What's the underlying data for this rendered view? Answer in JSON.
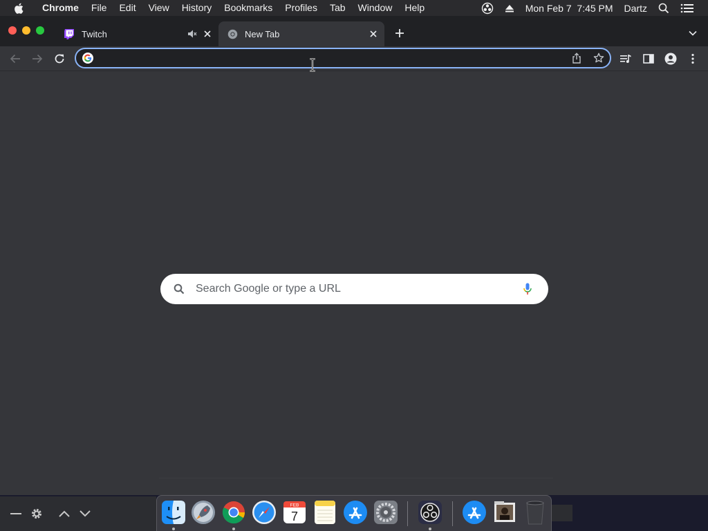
{
  "menubar": {
    "app_name": "Chrome",
    "items": [
      "File",
      "Edit",
      "View",
      "History",
      "Bookmarks",
      "Profiles",
      "Tab",
      "Window",
      "Help"
    ],
    "datetime": "Mon Feb 7  7:45 PM",
    "user": "Dartz"
  },
  "tabs": [
    {
      "title": "Twitch",
      "active": false,
      "muted": true
    },
    {
      "title": "New Tab",
      "active": true
    }
  ],
  "omnibox": {
    "value": "",
    "placeholder": ""
  },
  "ntp": {
    "search_placeholder": "Search Google or type a URL"
  },
  "dock": {
    "apps": [
      "Finder",
      "Launchpad",
      "Google Chrome",
      "Safari",
      "Calendar",
      "Notes",
      "App Store",
      "System Preferences",
      "OBS",
      "Applications",
      "Downloads",
      "Trash"
    ],
    "calendar": {
      "month": "FEB",
      "day": "7"
    }
  },
  "colors": {
    "accent": "#8ab4f8",
    "twitch": "#9146ff",
    "traffic_red": "#ff5f57",
    "traffic_yellow": "#febc2e",
    "traffic_green": "#28c840"
  }
}
